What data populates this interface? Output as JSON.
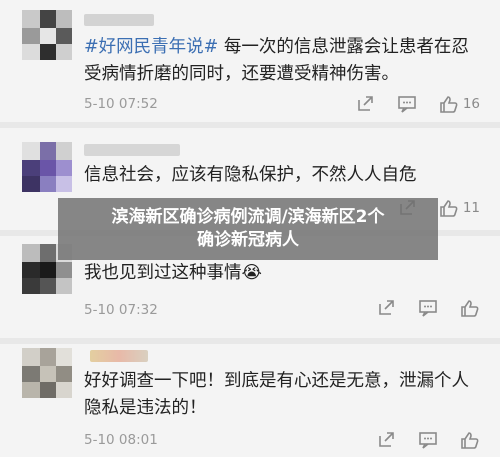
{
  "comments": [
    {
      "tag": "#好网民青年说#",
      "text": " 每一次的信息泄露会让患者在忍受病情折磨的同时，还要遭受精神伤害。",
      "time": "5-10 07:52",
      "likes": "16"
    },
    {
      "tag": "",
      "text": "信息社会，应该有隐私保护，不然人人自危",
      "time": "",
      "likes": "11"
    },
    {
      "tag": "",
      "text": "我也见到过这种事情",
      "emoji": "😭",
      "time": "5-10 07:32",
      "likes": ""
    },
    {
      "tag": "",
      "text": "好好调查一下吧！到底是有心还是无意，泄漏个人隐私是违法的！",
      "time": "5-10 08:01",
      "likes": "",
      "like_icon": "thumbs-up-icon"
    }
  ],
  "banner": {
    "line1": "滨海新区确诊病例流调/滨海新区2个",
    "line2": "确诊新冠病人"
  },
  "icons": [
    "share-icon",
    "comment-icon",
    "like-icon"
  ],
  "colors": {
    "tag": "#3c6fb3",
    "time": "#9a9a9a",
    "banner_bg": "#6e6e6e"
  }
}
